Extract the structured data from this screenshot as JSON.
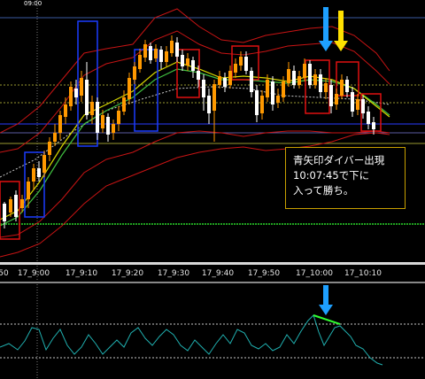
{
  "chart_data": [
    {
      "type": "candlestick",
      "title": "",
      "x_tick_labels": [
        "50",
        "17_9:00",
        "17_9:10",
        "17_9:20",
        "17_9:30",
        "17_9:40",
        "17_9:50",
        "17_10:00",
        "17_10:10"
      ],
      "top_timestamp": "09:00",
      "annotation": {
        "lines": [
          "青矢印ダイバー出現",
          "10:07:45で下に",
          "入って勝ち。"
        ]
      },
      "arrows": [
        {
          "color": "#1ea0ff",
          "direction": "down",
          "near": "17_10:05"
        },
        {
          "color": "#ffe000",
          "direction": "down",
          "near": "17_10:07"
        },
        {
          "color": "#1ea0ff",
          "direction": "down",
          "near": "17_10:05",
          "panel": "oscillator"
        }
      ],
      "candle_colors": {
        "up": "#ff9900",
        "down": "#ffffff"
      },
      "colors": {
        "bollinger": "#c81414",
        "range_box_blue": "#1a3cff",
        "range_box_red": "#e01010",
        "ma_yellow": "#d8d800",
        "ma_green": "#40c040",
        "level_olive": "#9a9a30",
        "level_green": "#20a020"
      }
    },
    {
      "type": "line",
      "panel": "oscillator",
      "divergence_line_color": "#30ff30",
      "series_color": "#20b0b0"
    }
  ]
}
